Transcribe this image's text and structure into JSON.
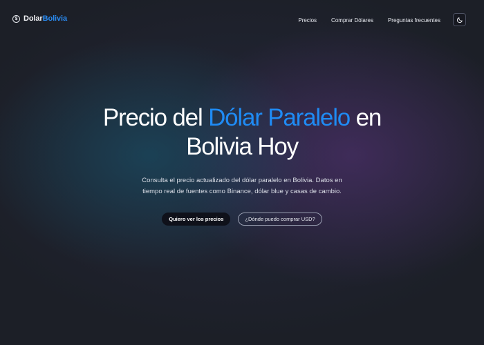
{
  "header": {
    "brand": {
      "name_part1": "Dolar",
      "name_part2": "Bolivia",
      "icon": "dollar-coin-icon"
    },
    "nav": [
      {
        "label": "Precios"
      },
      {
        "label": "Comprar Dólares"
      },
      {
        "label": "Preguntas frecuentes"
      }
    ],
    "theme_toggle": {
      "icon": "moon-icon"
    }
  },
  "hero": {
    "title_part1": "Precio del ",
    "title_accent": "Dólar Paralelo",
    "title_part2": " en",
    "title_line2": "Bolivia Hoy",
    "subtitle": "Consulta el precio actualizado del dólar paralelo en Bolivia. Datos en tiempo real de fuentes como Binance, dólar blue y casas de cambio.",
    "primary_button": "Quiero ver los precios",
    "secondary_button": "¿Dónde puedo comprar USD?"
  },
  "colors": {
    "background": "#1c1f27",
    "accent": "#1f8bf4",
    "brand_accent": "#2a8bf2",
    "text": "#ffffff",
    "button_dark": "#0f111a"
  }
}
